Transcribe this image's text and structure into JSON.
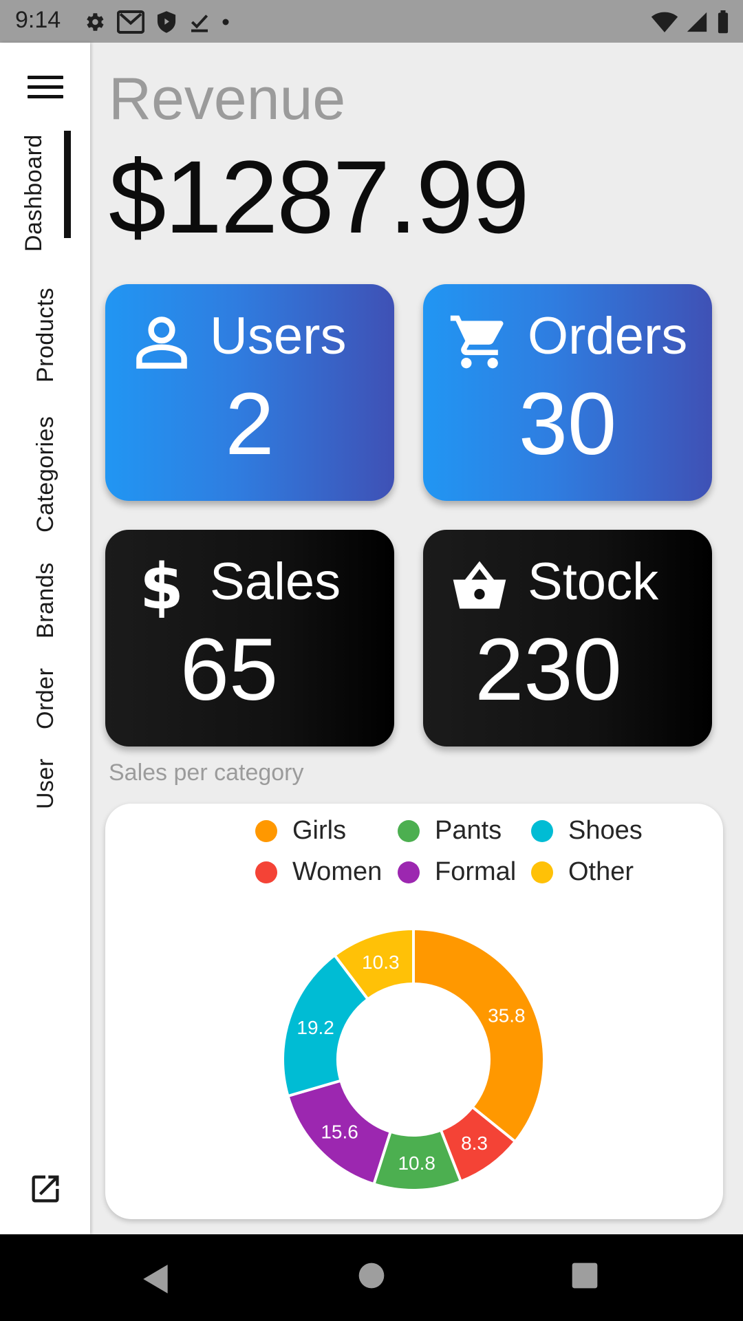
{
  "status_bar": {
    "time": "9:14",
    "left_icons": [
      "gear-icon",
      "gmail-icon",
      "shield-icon",
      "download-done-icon",
      "dot-icon"
    ],
    "right_icons": [
      "wifi-icon",
      "signal-icon",
      "battery-icon"
    ]
  },
  "sidebar": {
    "menu_icon": "hamburger-menu-icon",
    "items": [
      {
        "label": "Dashboard",
        "active": true
      },
      {
        "label": "Products",
        "active": false
      },
      {
        "label": "Categories",
        "active": false
      },
      {
        "label": "Brands",
        "active": false
      },
      {
        "label": "Order",
        "active": false
      },
      {
        "label": "User",
        "active": false
      }
    ],
    "footer_icon": "open-in-new-icon"
  },
  "revenue": {
    "label": "Revenue",
    "value": "$1287.99"
  },
  "cards": [
    {
      "title": "Users",
      "value": "2",
      "icon": "person-icon",
      "style": "blue"
    },
    {
      "title": "Orders",
      "value": "30",
      "icon": "cart-icon",
      "style": "blue"
    },
    {
      "title": "Sales",
      "value": "65",
      "icon": "dollar-icon",
      "style": "dark"
    },
    {
      "title": "Stock",
      "value": "230",
      "icon": "basket-icon",
      "style": "dark"
    }
  ],
  "chart_section": {
    "caption": "Sales per category"
  },
  "colors": {
    "girls": "#ff9800",
    "pants": "#4caf50",
    "shoes": "#00bcd4",
    "women": "#f44336",
    "formal": "#9c27b0",
    "other": "#ffc107",
    "card_blue_start": "#2196f3",
    "card_blue_end": "#3f51b5",
    "card_dark": "#111111"
  },
  "chart_data": {
    "type": "pie",
    "donut": true,
    "legend_position": "top",
    "categories": [
      "Girls",
      "Pants",
      "Shoes",
      "Women",
      "Formal",
      "Other"
    ],
    "values": [
      35.8,
      10.8,
      19.2,
      8.3,
      15.6,
      10.3
    ],
    "colors": [
      "#ff9800",
      "#4caf50",
      "#00bcd4",
      "#f44336",
      "#9c27b0",
      "#ffc107"
    ],
    "slice_order": [
      "Girls",
      "Women",
      "Pants",
      "Formal",
      "Shoes",
      "Other"
    ],
    "labels": [
      "35.8",
      "10.8",
      "19.2",
      "8.3",
      "15.6",
      "10.3"
    ]
  },
  "nav_bar": {
    "buttons": [
      "back-icon",
      "home-icon",
      "recents-icon"
    ]
  }
}
